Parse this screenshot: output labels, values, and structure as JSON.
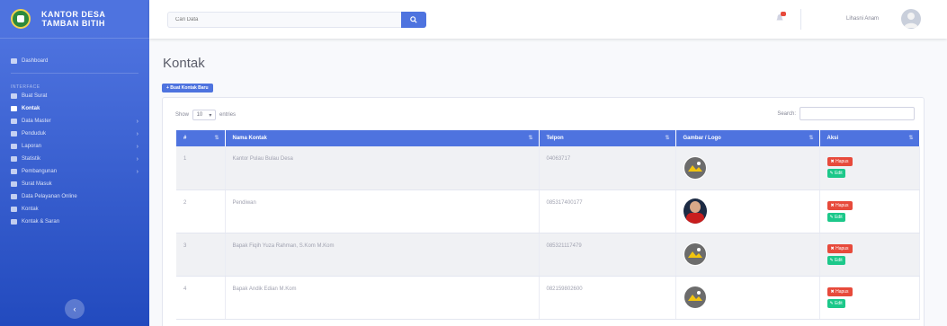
{
  "brand": {
    "line1": "KANTOR DESA",
    "line2": "TAMBAN BITIH"
  },
  "sidebar": {
    "items": [
      {
        "label": "Dashboard",
        "active": false,
        "chevron": false
      },
      {
        "heading": "INTERFACE"
      },
      {
        "label": "Buat Surat",
        "active": false,
        "chevron": false
      },
      {
        "label": "Kontak",
        "active": true,
        "chevron": false
      },
      {
        "label": "Data Master",
        "active": false,
        "chevron": true
      },
      {
        "label": "Penduduk",
        "active": false,
        "chevron": true
      },
      {
        "label": "Laporan",
        "active": false,
        "chevron": true
      },
      {
        "label": "Statistik",
        "active": false,
        "chevron": true
      },
      {
        "label": "Pembangunan",
        "active": false,
        "chevron": true
      },
      {
        "label": "Surat Masuk",
        "active": false,
        "chevron": false
      },
      {
        "label": "Data Pelayanan Online",
        "active": false,
        "chevron": false
      },
      {
        "label": "Kontak",
        "active": false,
        "chevron": false
      },
      {
        "label": "Kontak & Saran",
        "active": false,
        "chevron": false
      }
    ],
    "toggle_glyph": "‹"
  },
  "topbar": {
    "search_placeholder": "Cari Data",
    "user_name": "Lihasni Anam"
  },
  "page": {
    "title": "Kontak",
    "add_button": "+ Buat Kontak Baru"
  },
  "table_controls": {
    "show_label": "Show",
    "entries_value": "10",
    "entries_label": "entries",
    "search_label": "Search:"
  },
  "table": {
    "columns": [
      "#",
      "Nama Kontak",
      "Telpon",
      "Gambar / Logo",
      "Aksi"
    ],
    "rows": [
      {
        "no": "1",
        "name": "Kantor Pulau Bulau Desa",
        "phone": "04063717",
        "image": "logo"
      },
      {
        "no": "2",
        "name": "Pendiwan",
        "phone": "085317400177",
        "image": "photo"
      },
      {
        "no": "3",
        "name": "Bapak Fiqih Yuza Rahman, S.Kom M.Kom",
        "phone": "085321117479",
        "image": "logo"
      },
      {
        "no": "4",
        "name": "Bapak Andik Edian M.Kom",
        "phone": "082159802600",
        "image": "logo"
      }
    ],
    "delete_label": "✖ Hapus",
    "edit_label": "✎ Edit"
  },
  "colors": {
    "primary": "#4e73df",
    "danger": "#e74a3b",
    "success": "#1cc88a"
  }
}
